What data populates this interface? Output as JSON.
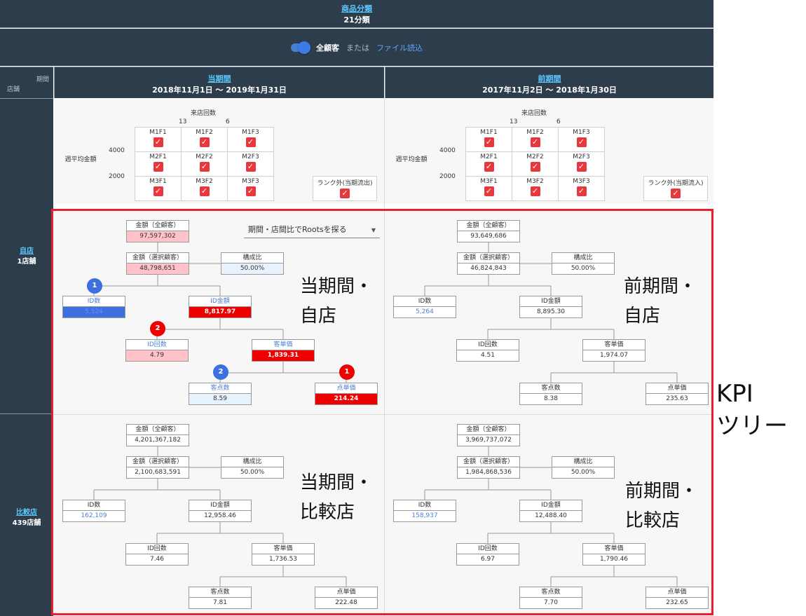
{
  "header": {
    "category_link": "商品分類",
    "category_count": "21分類"
  },
  "toggle": {
    "label": "全顧客",
    "or": "または",
    "file": "ファイル読込"
  },
  "corner": {
    "period": "期間",
    "store": "店舗"
  },
  "periods": {
    "current": {
      "link": "当期間",
      "range": "2018年11月1日 ～ 2019年1月31日"
    },
    "previous": {
      "link": "前期間",
      "range": "2017年11月2日 ～ 2018年1月30日"
    }
  },
  "stores": {
    "own": {
      "link": "自店",
      "count": "1店舗"
    },
    "compare": {
      "link": "比較店",
      "count": "439店舗"
    }
  },
  "rfm": {
    "title": "来店回数",
    "tick13": "13",
    "tick6": "6",
    "ylabel": "週平均金額",
    "y4000": "4000",
    "y2000": "2000",
    "cells": [
      "M1F1",
      "M1F2",
      "M1F3",
      "M2F1",
      "M2F2",
      "M2F3",
      "M3F1",
      "M3F2",
      "M3F3"
    ],
    "rank_out_current": "ランク外(当期流出)",
    "rank_out_previous": "ランク外(当期流入)",
    "check": "✓"
  },
  "dropdown": {
    "label": "期間・店間比でRootsを探る"
  },
  "labels": {
    "total": "金額（全顧客）",
    "selected": "金額（選択顧客）",
    "ratio": "構成比",
    "id_count": "ID数",
    "id_amount": "ID金額",
    "id_visits": "ID回数",
    "unit_price": "客単価",
    "items": "客点数",
    "item_price": "点単価"
  },
  "trees": {
    "cur_own": {
      "total": "97,597,302",
      "selected": "48,798,651",
      "ratio": "50.00%",
      "id_count": "5,524",
      "id_amount": "8,817.97",
      "id_visits": "4.79",
      "unit_price": "1,839.31",
      "items": "8.59",
      "item_price": "214.24"
    },
    "prev_own": {
      "total": "93,649,686",
      "selected": "46,824,843",
      "ratio": "50.00%",
      "id_count": "5,264",
      "id_amount": "8,895.30",
      "id_visits": "4.51",
      "unit_price": "1,974.07",
      "items": "8.38",
      "item_price": "235.63"
    },
    "cur_cmp": {
      "total": "4,201,367,182",
      "selected": "2,100,683,591",
      "ratio": "50.00%",
      "id_count": "162,109",
      "id_amount": "12,958.46",
      "id_visits": "7.46",
      "unit_price": "1,736.53",
      "items": "7.81",
      "item_price": "222.48"
    },
    "prev_cmp": {
      "total": "3,969,737,072",
      "selected": "1,984,868,536",
      "ratio": "50.00%",
      "id_count": "158,937",
      "id_amount": "12,488.40",
      "id_visits": "6.97",
      "unit_price": "1,790.46",
      "items": "7.70",
      "item_price": "232.65"
    }
  },
  "badges": {
    "b1": "1",
    "r2": "2",
    "b2": "2",
    "r1": "1"
  },
  "annotations": {
    "cur_own": [
      "当期間・",
      "自店"
    ],
    "prev_own": [
      "前期間・",
      "自店"
    ],
    "cur_cmp": [
      "当期間・",
      "比較店"
    ],
    "prev_cmp": [
      "前期間・",
      "比較店"
    ],
    "kpi": [
      "KPI",
      "ツリー"
    ]
  }
}
